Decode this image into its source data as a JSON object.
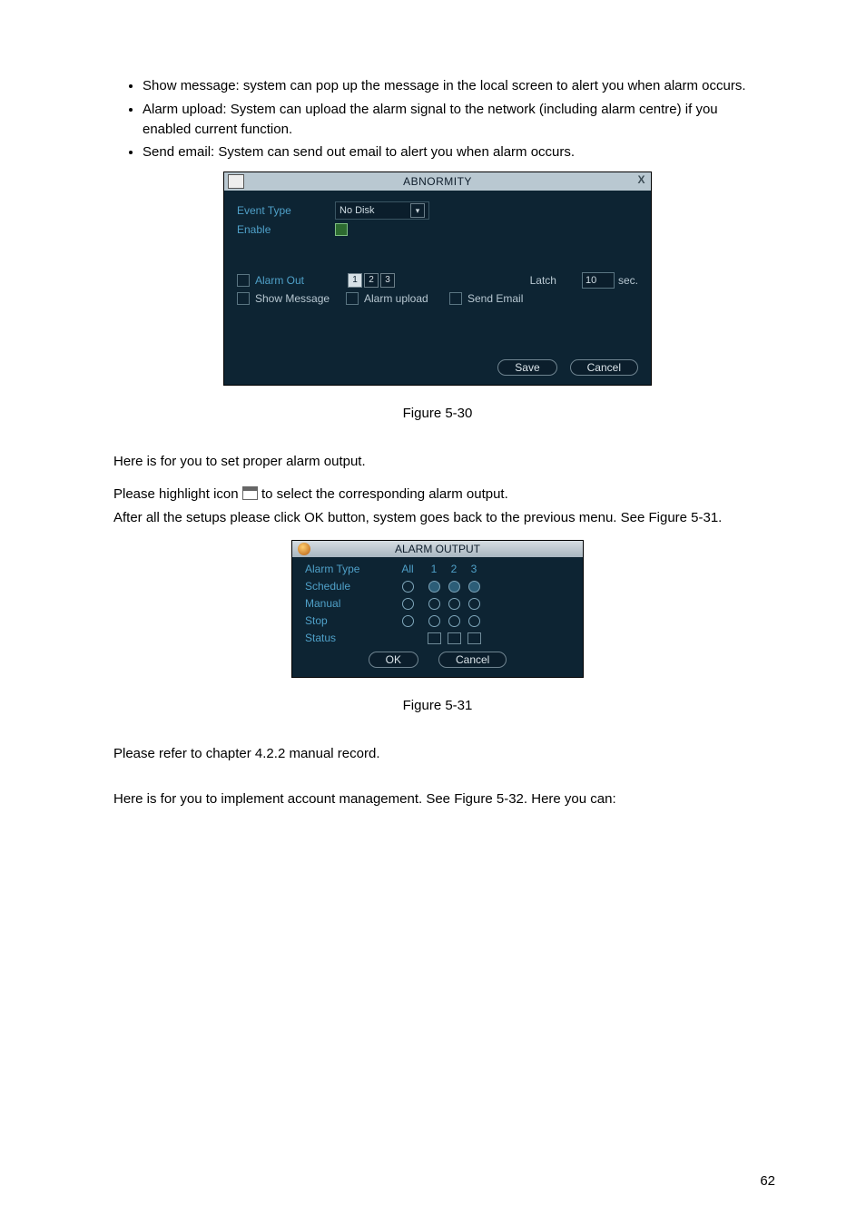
{
  "bullets": {
    "b1": "Show message: system can pop up the message in the local screen to alert you when alarm occurs.",
    "b2": "Alarm upload: System can upload the alarm signal to the network (including alarm centre) if you enabled current function.",
    "b3": "Send email: System can send out email to alert you when alarm occurs."
  },
  "dlg1": {
    "title": "ABNORMITY",
    "close": "X",
    "event_type_label": "Event Type",
    "event_type_value": "No Disk",
    "enable_label": "Enable",
    "alarm_out_label": "Alarm Out",
    "alarm_out_n1": "1",
    "alarm_out_n2": "2",
    "alarm_out_n3": "3",
    "latch_label": "Latch",
    "latch_value": "10",
    "latch_unit": "sec.",
    "show_message_label": "Show Message",
    "alarm_upload_label": "Alarm upload",
    "send_email_label": "Send Email",
    "save": "Save",
    "cancel": "Cancel"
  },
  "fig1": "Figure 5-30",
  "para1": "Here is for you to set proper alarm output.",
  "para2a": "Please highlight icon ",
  "para2b": " to select the corresponding alarm output.",
  "para3": "After all the setups please click OK button, system goes back to the previous menu. See Figure 5-31.",
  "dlg2": {
    "title": "ALARM OUTPUT",
    "alarm_type": "Alarm Type",
    "all": "All",
    "c1": "1",
    "c2": "2",
    "c3": "3",
    "schedule": "Schedule",
    "manual": "Manual",
    "stop": "Stop",
    "status": "Status",
    "ok": "OK",
    "cancel": "Cancel"
  },
  "fig2": "Figure 5-31",
  "para4": "Please refer to chapter 4.2.2 manual record.",
  "para5": "Here is for you to implement account management.  See Figure 5-32. Here you can:",
  "page_number": "62"
}
